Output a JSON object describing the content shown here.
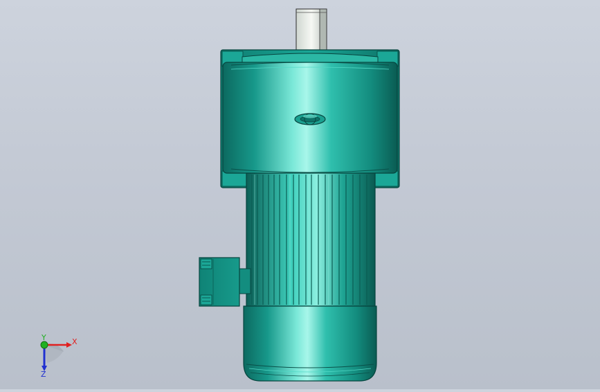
{
  "viewport": {
    "background_top": "#cdd3dd",
    "background_bottom": "#b9c0cb"
  },
  "model": {
    "body_color": "#1a9c8c",
    "highlight_color": "#8ff0e0",
    "shadow_color": "#0b5d54",
    "shaft_color": "#eef2ee"
  },
  "triad": {
    "x_label": "X",
    "y_label": "Y",
    "z_label": "Z",
    "x_color": "#e02020",
    "y_color": "#20b020",
    "z_color": "#2030d0"
  }
}
